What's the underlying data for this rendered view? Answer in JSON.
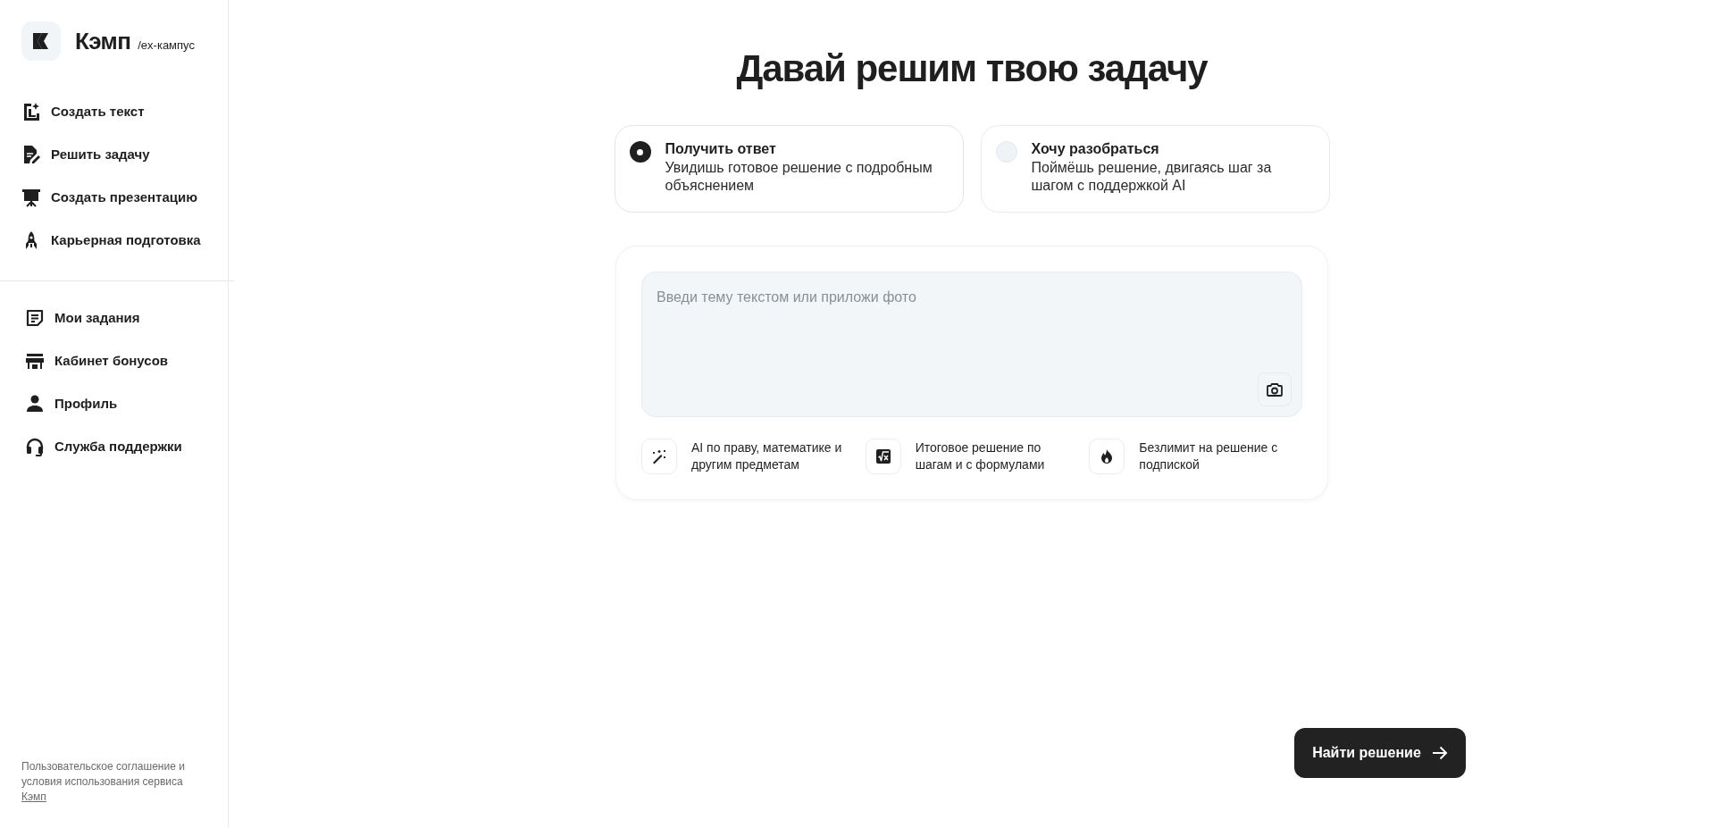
{
  "brand": {
    "name": "Кэмп",
    "subtitle": "/ex-кампус"
  },
  "sidebar": {
    "primary_items": [
      {
        "label": "Создать текст"
      },
      {
        "label": "Решить задачу"
      },
      {
        "label": "Создать презентацию"
      },
      {
        "label": "Карьерная подготовка"
      }
    ],
    "secondary_items": [
      {
        "label": "Мои задания"
      },
      {
        "label": "Кабинет бонусов"
      },
      {
        "label": "Профиль"
      },
      {
        "label": "Служба поддержки"
      }
    ],
    "footer": {
      "text": "Пользовательское соглашение и условия использования сервиса",
      "link": "Кэмп"
    }
  },
  "heading": "Давай решим твою задачу",
  "modes": [
    {
      "title": "Получить ответ",
      "description": "Увидишь готовое решение с подробным объяснением",
      "selected": true
    },
    {
      "title": "Хочу разобраться",
      "description": "Поймёшь решение, двигаясь шаг за шагом с поддержкой AI",
      "selected": false
    }
  ],
  "input": {
    "placeholder": "Введи тему текстом или приложи фото"
  },
  "features": [
    {
      "text": "AI по праву, математике и другим предметам"
    },
    {
      "text": "Итоговое решение по шагам и с формулами"
    },
    {
      "text": "Безлимит на решение с подпиской"
    }
  ],
  "submit_button": "Найти решение"
}
